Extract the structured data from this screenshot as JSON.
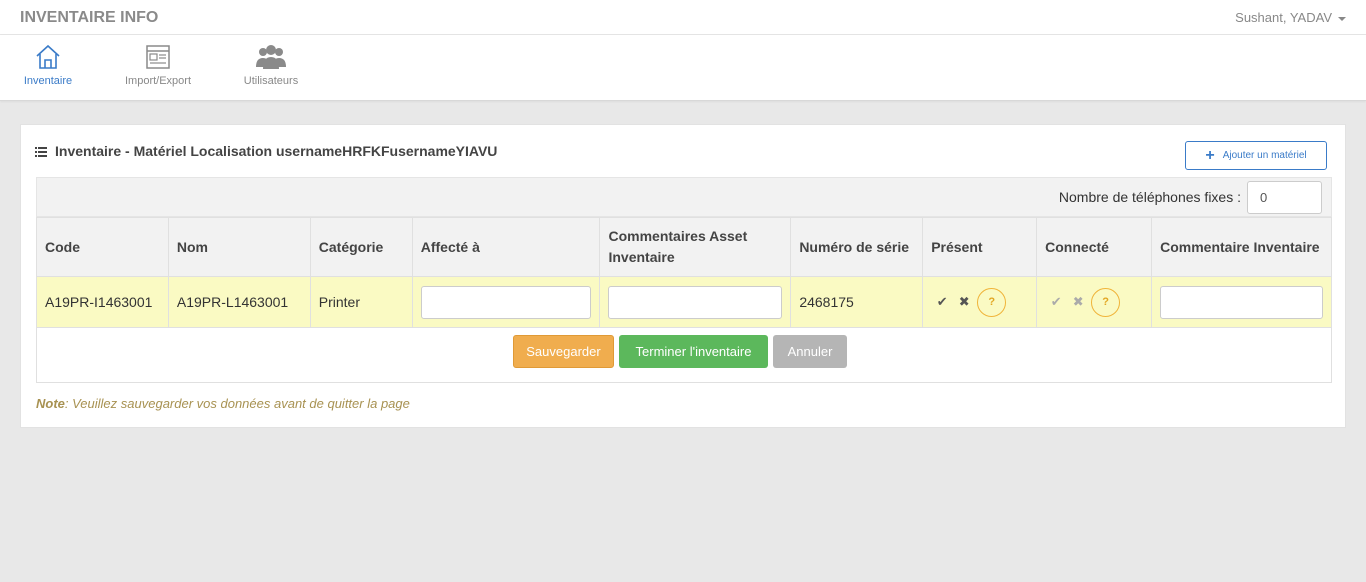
{
  "app": {
    "title": "INVENTAIRE INFO",
    "user": "Sushant, YADAV"
  },
  "nav": {
    "items": [
      {
        "label": "Inventaire",
        "icon": "home-icon",
        "active": true
      },
      {
        "label": "Import/Export",
        "icon": "import-export-icon",
        "active": false
      },
      {
        "label": "Utilisateurs",
        "icon": "users-icon",
        "active": false
      }
    ]
  },
  "panel": {
    "title": "Inventaire - Matériel Localisation usernameHRFKFusernameYIAVU",
    "add_button": "Ajouter un matériel",
    "phones_label": "Nombre de téléphones fixes :",
    "phones_value": "0"
  },
  "table": {
    "headers": [
      "Code",
      "Nom",
      "Catégorie",
      "Affecté à",
      "Commentaires Asset Inventaire",
      "Numéro de série",
      "Présent",
      "Connecté",
      "Commentaire Inventaire"
    ],
    "rows": [
      {
        "code": "A19PR-I1463001",
        "nom": "A19PR-L1463001",
        "categorie": "Printer",
        "affecte": "",
        "commentaires_asset": "",
        "numero_serie": "2468175",
        "present": "unknown",
        "connecte": "unknown",
        "commentaire_inventaire": ""
      }
    ]
  },
  "tristate": {
    "check": "✔",
    "cross": "✖",
    "question": "?"
  },
  "actions": {
    "save": "Sauvegarder",
    "finish": "Terminer l'inventaire",
    "cancel": "Annuler"
  },
  "note": {
    "label": "Note",
    "text": ": Veuillez sauvegarder vos données avant de quitter la page"
  },
  "colors": {
    "accent": "#3a7bc8",
    "save": "#f0ad4e",
    "finish": "#5cb85c",
    "cancel": "#b5b5b5",
    "row_highlight": "#fafac3"
  }
}
